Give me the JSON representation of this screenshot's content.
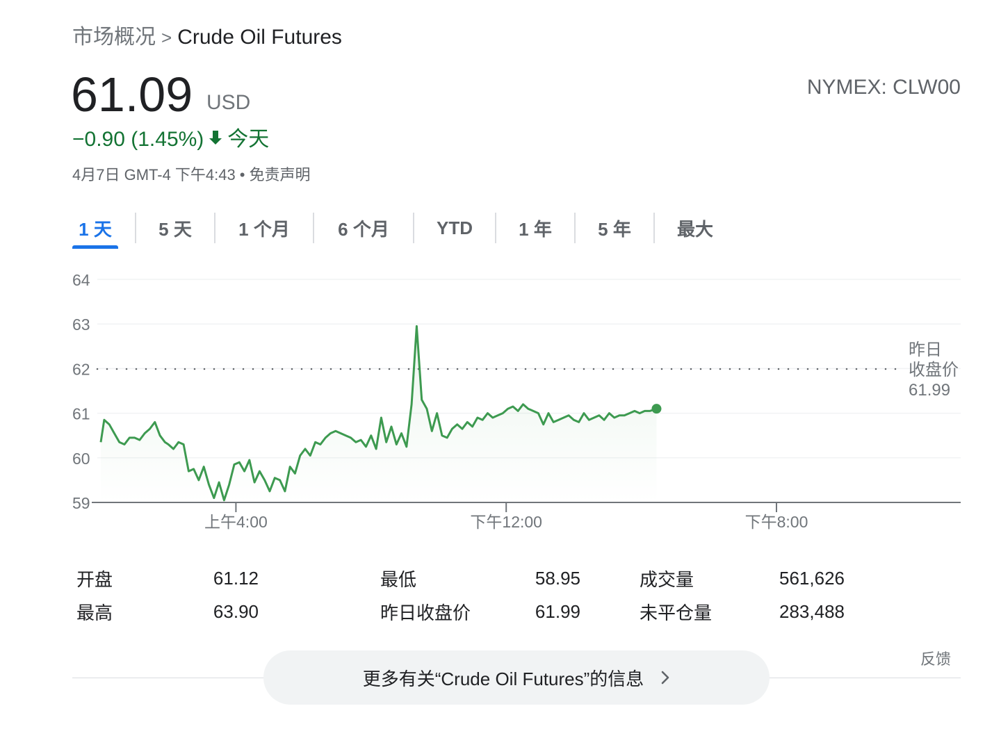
{
  "breadcrumb": {
    "parent": "市场概况",
    "separator": ">",
    "current": "Crude Oil Futures"
  },
  "quote": {
    "price": "61.09",
    "currency": "USD",
    "exchange_symbol": "NYMEX: CLW00",
    "change": "−0.90 (1.45%)",
    "change_period": "今天",
    "timestamp": "4月7日 GMT-4 下午4:43",
    "disclaimer": "免责声明"
  },
  "tabs": [
    "1 天",
    "5 天",
    "1 个月",
    "6 个月",
    "YTD",
    "1 年",
    "5 年",
    "最大"
  ],
  "active_tab": 0,
  "colors": {
    "line": "#3d9a50",
    "accent": "#1a73e8",
    "down": "#137333"
  },
  "chart_data": {
    "type": "line",
    "y_ticks": [
      "64",
      "63",
      "62",
      "61",
      "60",
      "59"
    ],
    "ylim": [
      59,
      64
    ],
    "x_ticks": [
      "上午4:00",
      "下午12:00",
      "下午8:00"
    ],
    "x_tick_hours": [
      4,
      12,
      20
    ],
    "xlim_hours": [
      0,
      24
    ],
    "previous_close": {
      "label_line1": "昨日",
      "label_line2": "收盘价",
      "value": "61.99",
      "level": 61.99
    },
    "series": [
      {
        "x": [
          0.0,
          0.1,
          0.25,
          0.4,
          0.55,
          0.7,
          0.85,
          1.0,
          1.15,
          1.3,
          1.45,
          1.6,
          1.75,
          1.9,
          2.0,
          2.15,
          2.3,
          2.45,
          2.6,
          2.75,
          2.9,
          3.05,
          3.2,
          3.35,
          3.5,
          3.65,
          3.8,
          3.95,
          4.1,
          4.25,
          4.4,
          4.55,
          4.7,
          4.85,
          5.0,
          5.15,
          5.3,
          5.45,
          5.6,
          5.75,
          5.9,
          6.05,
          6.2,
          6.35,
          6.5,
          6.65,
          6.8,
          6.95,
          7.1,
          7.25,
          7.4,
          7.55,
          7.7,
          7.85,
          8.0,
          8.15,
          8.3,
          8.45,
          8.6,
          8.75,
          8.9,
          9.05,
          9.2,
          9.35,
          9.5,
          9.65,
          9.8,
          9.95,
          10.1,
          10.25,
          10.4,
          10.55,
          10.7,
          10.85,
          11.0,
          11.15,
          11.3,
          11.45,
          11.6,
          11.75,
          11.9,
          12.05,
          12.2,
          12.35,
          12.5,
          12.65,
          12.8,
          12.95,
          13.1,
          13.25,
          13.4,
          13.55,
          13.7,
          13.85,
          14.0,
          14.15,
          14.3,
          14.45,
          14.6,
          14.75,
          14.9,
          15.05,
          15.2,
          15.35,
          15.5,
          15.65,
          15.8,
          15.95,
          16.1,
          16.25,
          16.45
        ],
        "y": [
          60.35,
          60.85,
          60.75,
          60.55,
          60.35,
          60.3,
          60.45,
          60.45,
          60.4,
          60.55,
          60.65,
          60.8,
          60.5,
          60.35,
          60.3,
          60.2,
          60.35,
          60.3,
          59.7,
          59.75,
          59.5,
          59.8,
          59.4,
          59.1,
          59.45,
          59.05,
          59.4,
          59.85,
          59.9,
          59.7,
          59.95,
          59.45,
          59.7,
          59.5,
          59.25,
          59.55,
          59.5,
          59.25,
          59.8,
          59.65,
          60.05,
          60.2,
          60.05,
          60.35,
          60.3,
          60.45,
          60.55,
          60.6,
          60.55,
          60.5,
          60.45,
          60.35,
          60.4,
          60.25,
          60.5,
          60.2,
          60.9,
          60.35,
          60.7,
          60.3,
          60.55,
          60.25,
          61.2,
          62.95,
          61.3,
          61.1,
          60.6,
          61.0,
          60.5,
          60.45,
          60.65,
          60.75,
          60.65,
          60.8,
          60.7,
          60.9,
          60.85,
          61.0,
          60.9,
          60.95,
          61.0,
          61.1,
          61.15,
          61.05,
          61.2,
          61.1,
          61.05,
          61.0,
          60.75,
          61.0,
          60.8,
          60.85,
          60.9,
          60.95,
          60.85,
          60.8,
          61.0,
          60.85,
          60.9,
          60.95,
          60.85,
          61.0,
          60.9,
          60.95,
          60.95,
          61.0,
          61.05,
          61.0,
          61.05,
          61.05,
          61.1
        ]
      }
    ]
  },
  "stats": [
    [
      {
        "label": "开盘",
        "value": "61.12"
      },
      {
        "label": "最低",
        "value": "58.95"
      },
      {
        "label": "成交量",
        "value": "561,626"
      }
    ],
    [
      {
        "label": "最高",
        "value": "63.90"
      },
      {
        "label": "昨日收盘价",
        "value": "61.99"
      },
      {
        "label": "未平仓量",
        "value": "283,488"
      }
    ]
  ],
  "feedback": "反馈",
  "more_info": "更多有关“Crude Oil Futures”的信息"
}
